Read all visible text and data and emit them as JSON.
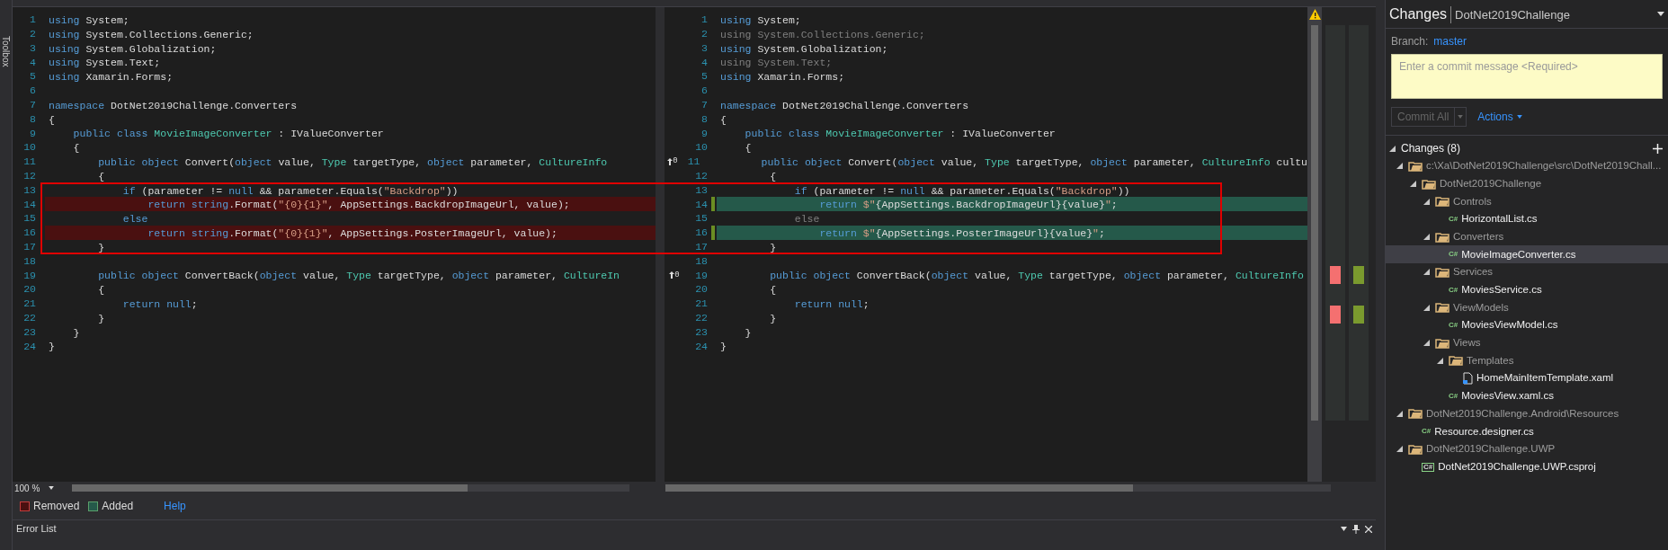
{
  "side_strip": {
    "label": "Toolbox"
  },
  "diff": {
    "panes": [
      {
        "kind": "base",
        "lines": [
          {
            "n": "1",
            "changed": false,
            "tokens": [
              {
                "kind": "kw",
                "text": "using"
              },
              {
                "kind": "plain",
                "text": " System;"
              }
            ]
          },
          {
            "n": "2",
            "changed": false,
            "tokens": [
              {
                "kind": "kw",
                "text": "using"
              },
              {
                "kind": "plain",
                "text": " System.Collections.Generic;"
              }
            ]
          },
          {
            "n": "3",
            "changed": false,
            "tokens": [
              {
                "kind": "kw",
                "text": "using"
              },
              {
                "kind": "plain",
                "text": " System.Globalization;"
              }
            ]
          },
          {
            "n": "4",
            "changed": false,
            "tokens": [
              {
                "kind": "kw",
                "text": "using"
              },
              {
                "kind": "plain",
                "text": " System.Text;"
              }
            ]
          },
          {
            "n": "5",
            "changed": false,
            "tokens": [
              {
                "kind": "kw",
                "text": "using"
              },
              {
                "kind": "plain",
                "text": " Xamarin.Forms;"
              }
            ]
          },
          {
            "n": "6",
            "changed": false
          },
          {
            "n": "7",
            "changed": false,
            "tokens": [
              {
                "kind": "kw",
                "text": "namespace"
              },
              {
                "kind": "plain",
                "text": " DotNet2019Challenge.Converters"
              }
            ]
          },
          {
            "n": "8",
            "changed": false,
            "tokens": [
              {
                "kind": "plain",
                "text": "{"
              }
            ]
          },
          {
            "n": "9",
            "changed": false,
            "tokens": [
              {
                "kind": "kw",
                "text": "    public"
              },
              {
                "kind": "kw",
                "text": " class"
              },
              {
                "kind": "type",
                "text": " MovieImageConverter"
              },
              {
                "kind": "plain",
                "text": " : IValueConverter"
              }
            ]
          },
          {
            "n": "10",
            "changed": false,
            "tokens": [
              {
                "kind": "plain",
                "text": "    {"
              }
            ]
          },
          {
            "n": "11",
            "changed": false,
            "tokens": [
              {
                "kind": "kw",
                "text": "        public"
              },
              {
                "kind": "kw",
                "text": " object"
              },
              {
                "kind": "plain",
                "text": " Convert("
              },
              {
                "kind": "kw",
                "text": "object"
              },
              {
                "kind": "plain",
                "text": " value, "
              },
              {
                "kind": "type",
                "text": "Type"
              },
              {
                "kind": "plain",
                "text": " targetType, "
              },
              {
                "kind": "kw",
                "text": "object"
              },
              {
                "kind": "plain",
                "text": " parameter, "
              },
              {
                "kind": "type",
                "text": "CultureInfo"
              }
            ]
          },
          {
            "n": "12",
            "changed": false,
            "tokens": [
              {
                "kind": "plain",
                "text": "        {"
              }
            ]
          },
          {
            "n": "13",
            "changed": false,
            "tokens": [
              {
                "kind": "kw",
                "text": "            if"
              },
              {
                "kind": "plain",
                "text": " (parameter != "
              },
              {
                "kind": "kw",
                "text": "null"
              },
              {
                "kind": "plain",
                "text": " && parameter.Equals("
              },
              {
                "kind": "str",
                "text": "\"Backdrop\""
              },
              {
                "kind": "plain",
                "text": "))"
              }
            ]
          },
          {
            "n": "14",
            "changed": true,
            "tokens": [
              {
                "kind": "kw",
                "text": "                return"
              },
              {
                "kind": "kw",
                "text": " string"
              },
              {
                "kind": "plain",
                "text": ".Format("
              },
              {
                "kind": "str",
                "text": "\"{0}{1}\""
              },
              {
                "kind": "plain",
                "text": ", AppSettings.BackdropImageUrl, value);"
              }
            ]
          },
          {
            "n": "15",
            "changed": false,
            "tokens": [
              {
                "kind": "kw",
                "text": "            else"
              }
            ]
          },
          {
            "n": "16",
            "changed": true,
            "tokens": [
              {
                "kind": "kw",
                "text": "                return"
              },
              {
                "kind": "kw",
                "text": " string"
              },
              {
                "kind": "plain",
                "text": ".Format("
              },
              {
                "kind": "str",
                "text": "\"{0}{1}\""
              },
              {
                "kind": "plain",
                "text": ", AppSettings.PosterImageUrl, value);"
              }
            ]
          },
          {
            "n": "17",
            "changed": false,
            "tokens": [
              {
                "kind": "plain",
                "text": "        }"
              }
            ]
          },
          {
            "n": "18",
            "changed": false
          },
          {
            "n": "19",
            "changed": false,
            "tokens": [
              {
                "kind": "kw",
                "text": "        public"
              },
              {
                "kind": "kw",
                "text": " object"
              },
              {
                "kind": "plain",
                "text": " ConvertBack("
              },
              {
                "kind": "kw",
                "text": "object"
              },
              {
                "kind": "plain",
                "text": " value, "
              },
              {
                "kind": "type",
                "text": "Type"
              },
              {
                "kind": "plain",
                "text": " targetType, "
              },
              {
                "kind": "kw",
                "text": "object"
              },
              {
                "kind": "plain",
                "text": " parameter, "
              },
              {
                "kind": "type",
                "text": "CultureIn"
              }
            ]
          },
          {
            "n": "20",
            "changed": false,
            "tokens": [
              {
                "kind": "plain",
                "text": "        {"
              }
            ]
          },
          {
            "n": "21",
            "changed": false,
            "tokens": [
              {
                "kind": "kw",
                "text": "            return"
              },
              {
                "kind": "kw",
                "text": " null"
              },
              {
                "kind": "plain",
                "text": ";"
              }
            ]
          },
          {
            "n": "22",
            "changed": false,
            "tokens": [
              {
                "kind": "plain",
                "text": "        }"
              }
            ]
          },
          {
            "n": "23",
            "changed": false,
            "tokens": [
              {
                "kind": "plain",
                "text": "    }"
              }
            ]
          },
          {
            "n": "24",
            "changed": false,
            "tokens": [
              {
                "kind": "plain",
                "text": "}"
              }
            ]
          }
        ]
      },
      {
        "kind": "modified",
        "lines": [
          {
            "n": "1",
            "changed": false,
            "tokens": [
              {
                "kind": "kw",
                "text": "using"
              },
              {
                "kind": "plain",
                "text": " System;"
              }
            ]
          },
          {
            "n": "2",
            "changed": false,
            "tokens": [
              {
                "kind": "dim",
                "text": "using System.Collections.Generic;"
              }
            ]
          },
          {
            "n": "3",
            "changed": false,
            "tokens": [
              {
                "kind": "kw",
                "text": "using"
              },
              {
                "kind": "plain",
                "text": " System.Globalization;"
              }
            ]
          },
          {
            "n": "4",
            "changed": false,
            "tokens": [
              {
                "kind": "dim",
                "text": "using System.Text;"
              }
            ]
          },
          {
            "n": "5",
            "changed": false,
            "tokens": [
              {
                "kind": "kw",
                "text": "using"
              },
              {
                "kind": "plain",
                "text": " Xamarin.Forms;"
              }
            ]
          },
          {
            "n": "6",
            "changed": false
          },
          {
            "n": "7",
            "changed": false,
            "tokens": [
              {
                "kind": "kw",
                "text": "namespace"
              },
              {
                "kind": "plain",
                "text": " DotNet2019Challenge.Converters"
              }
            ]
          },
          {
            "n": "8",
            "changed": false,
            "tokens": [
              {
                "kind": "plain",
                "text": "{"
              }
            ]
          },
          {
            "n": "9",
            "changed": false,
            "tokens": [
              {
                "kind": "kw",
                "text": "    public"
              },
              {
                "kind": "kw",
                "text": " class"
              },
              {
                "kind": "type",
                "text": " MovieImageConverter"
              },
              {
                "kind": "plain",
                "text": " : IValueConverter"
              }
            ]
          },
          {
            "n": "10",
            "changed": false,
            "tokens": [
              {
                "kind": "plain",
                "text": "    {"
              }
            ]
          },
          {
            "n": "11",
            "changed": false,
            "refs": "0",
            "tokens": [
              {
                "kind": "kw",
                "text": "        public"
              },
              {
                "kind": "kw",
                "text": " object"
              },
              {
                "kind": "plain",
                "text": " Convert("
              },
              {
                "kind": "kw",
                "text": "object"
              },
              {
                "kind": "plain",
                "text": " value, "
              },
              {
                "kind": "type",
                "text": "Type"
              },
              {
                "kind": "plain",
                "text": " targetType, "
              },
              {
                "kind": "kw",
                "text": "object"
              },
              {
                "kind": "plain",
                "text": " parameter, "
              },
              {
                "kind": "type",
                "text": "CultureInfo"
              },
              {
                "kind": "plain",
                "text": " cultu"
              }
            ]
          },
          {
            "n": "12",
            "changed": false,
            "tokens": [
              {
                "kind": "plain",
                "text": "        {"
              }
            ]
          },
          {
            "n": "13",
            "changed": false,
            "tokens": [
              {
                "kind": "kw",
                "text": "            if"
              },
              {
                "kind": "plain",
                "text": " (parameter != "
              },
              {
                "kind": "kw",
                "text": "null"
              },
              {
                "kind": "plain",
                "text": " && parameter.Equals("
              },
              {
                "kind": "str",
                "text": "\"Backdrop\""
              },
              {
                "kind": "plain",
                "text": "))"
              }
            ]
          },
          {
            "n": "14",
            "changed": true,
            "tokens": [
              {
                "kind": "kw",
                "text": "                return"
              },
              {
                "kind": "str",
                "text": " $\""
              },
              {
                "kind": "plain",
                "text": "{AppSettings.BackdropImageUrl}{value}"
              },
              {
                "kind": "str",
                "text": "\""
              },
              {
                "kind": "plain",
                "text": ";"
              }
            ]
          },
          {
            "n": "15",
            "changed": false,
            "tokens": [
              {
                "kind": "dim",
                "text": "            else"
              }
            ]
          },
          {
            "n": "16",
            "changed": true,
            "tokens": [
              {
                "kind": "kw",
                "text": "                return"
              },
              {
                "kind": "str",
                "text": " $\""
              },
              {
                "kind": "plain",
                "text": "{AppSettings.PosterImageUrl}{value}"
              },
              {
                "kind": "str",
                "text": "\""
              },
              {
                "kind": "plain",
                "text": ";"
              }
            ]
          },
          {
            "n": "17",
            "changed": false,
            "tokens": [
              {
                "kind": "plain",
                "text": "        }"
              }
            ]
          },
          {
            "n": "18",
            "changed": false
          },
          {
            "n": "19",
            "changed": false,
            "refs": "0",
            "tokens": [
              {
                "kind": "kw",
                "text": "        public"
              },
              {
                "kind": "kw",
                "text": " object"
              },
              {
                "kind": "plain",
                "text": " ConvertBack("
              },
              {
                "kind": "kw",
                "text": "object"
              },
              {
                "kind": "plain",
                "text": " value, "
              },
              {
                "kind": "type",
                "text": "Type"
              },
              {
                "kind": "plain",
                "text": " targetType, "
              },
              {
                "kind": "kw",
                "text": "object"
              },
              {
                "kind": "plain",
                "text": " parameter, "
              },
              {
                "kind": "type",
                "text": "CultureInfo"
              }
            ]
          },
          {
            "n": "20",
            "changed": false,
            "tokens": [
              {
                "kind": "plain",
                "text": "        {"
              }
            ]
          },
          {
            "n": "21",
            "changed": false,
            "tokens": [
              {
                "kind": "kw",
                "text": "            return"
              },
              {
                "kind": "kw",
                "text": " null"
              },
              {
                "kind": "plain",
                "text": ";"
              }
            ]
          },
          {
            "n": "22",
            "changed": false,
            "tokens": [
              {
                "kind": "plain",
                "text": "        }"
              }
            ]
          },
          {
            "n": "23",
            "changed": false,
            "tokens": [
              {
                "kind": "plain",
                "text": "    }"
              }
            ]
          },
          {
            "n": "24",
            "changed": false,
            "tokens": [
              {
                "kind": "plain",
                "text": "}"
              }
            ]
          }
        ]
      }
    ]
  },
  "zoom": {
    "value": "100 %"
  },
  "legend": [
    {
      "kind": "removed",
      "label": "Removed"
    },
    {
      "kind": "added",
      "label": "Added"
    },
    {
      "kind": "link",
      "label": "Help"
    }
  ],
  "error_list": {
    "title": "Error List"
  },
  "changes_panel": {
    "title": "Changes",
    "repo": "DotNet2019Challenge",
    "branch_label": "Branch:",
    "branch": "master",
    "commit_placeholder": "Enter a commit message <Required>",
    "commit_button": {
      "label": "Commit All",
      "disabled": true
    },
    "actions": "Actions",
    "section": {
      "label": "Changes (8)",
      "expanded": true
    },
    "tree": [
      {
        "kind": "folder",
        "name": "c:\\Xa\\DotNet2019Challenge\\src\\DotNet2019Chall...",
        "expanded": true,
        "selected": false,
        "children": [
          {
            "kind": "folder",
            "name": "DotNet2019Challenge",
            "expanded": true,
            "selected": false,
            "children": [
              {
                "kind": "folder",
                "name": "Controls",
                "expanded": true,
                "selected": false,
                "children": [
                  {
                    "kind": "cs",
                    "icon_text": "C#",
                    "name": "HorizontalList.cs",
                    "selected": false
                  }
                ]
              },
              {
                "kind": "folder",
                "name": "Converters",
                "expanded": true,
                "selected": false,
                "children": [
                  {
                    "kind": "cs",
                    "icon_text": "C#",
                    "name": "MovieImageConverter.cs",
                    "selected": true
                  }
                ]
              },
              {
                "kind": "folder",
                "name": "Services",
                "expanded": true,
                "selected": false,
                "children": [
                  {
                    "kind": "cs",
                    "icon_text": "C#",
                    "name": "MoviesService.cs",
                    "selected": false
                  }
                ]
              },
              {
                "kind": "folder",
                "name": "ViewModels",
                "expanded": true,
                "selected": false,
                "children": [
                  {
                    "kind": "cs",
                    "icon_text": "C#",
                    "name": "MoviesViewModel.cs",
                    "selected": false
                  }
                ]
              },
              {
                "kind": "folder",
                "name": "Views",
                "expanded": true,
                "selected": false,
                "children": [
                  {
                    "kind": "folder",
                    "name": "Templates",
                    "expanded": true,
                    "selected": false,
                    "children": [
                      {
                        "kind": "xaml",
                        "name": "HomeMainItemTemplate.xaml",
                        "selected": false
                      }
                    ]
                  },
                  {
                    "kind": "cs",
                    "icon_text": "C#",
                    "name": "MoviesView.xaml.cs",
                    "selected": false
                  }
                ]
              }
            ]
          }
        ]
      },
      {
        "kind": "folder",
        "name": "DotNet2019Challenge.Android\\Resources",
        "expanded": true,
        "selected": false,
        "children": [
          {
            "kind": "cs",
            "icon_text": "C#",
            "name": "Resource.designer.cs",
            "selected": false
          }
        ]
      },
      {
        "kind": "folder",
        "name": "DotNet2019Challenge.UWP",
        "expanded": true,
        "selected": false,
        "children": [
          {
            "kind": "csproj",
            "icon_text": "C#",
            "name": "DotNet2019Challenge.UWP.csproj",
            "selected": false
          }
        ]
      }
    ]
  }
}
